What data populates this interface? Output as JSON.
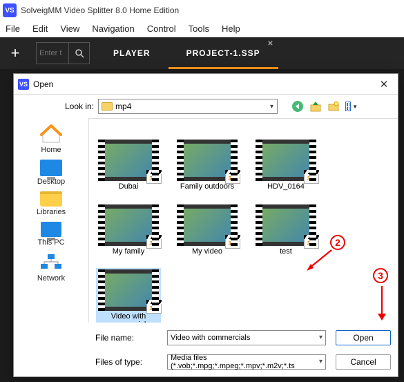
{
  "app": {
    "title": "SolveigMM Video Splitter 8.0 Home Edition",
    "logo_text": "VS"
  },
  "menu": {
    "file": "File",
    "edit": "Edit",
    "view": "View",
    "navigation": "Navigation",
    "control": "Control",
    "tools": "Tools",
    "help": "Help"
  },
  "toolbar": {
    "search_placeholder": "Enter t",
    "player_tab": "PLAYER",
    "project_tab": "PROJECT-1.SSP"
  },
  "dialog": {
    "title": "Open",
    "lookin_label": "Look in:",
    "current_folder": "mp4",
    "places": {
      "home": "Home",
      "desktop": "Desktop",
      "libraries": "Libraries",
      "thispc": "This PC",
      "network": "Network"
    },
    "files": [
      {
        "label": "Dubai"
      },
      {
        "label": "Family outdoors"
      },
      {
        "label": "HDV_0164"
      },
      {
        "label": "My family"
      },
      {
        "label": "My video"
      },
      {
        "label": "test"
      },
      {
        "label": "Video with commercials"
      }
    ],
    "filename_label": "File name:",
    "filename_value": "Video with commercials",
    "filetype_label": "Files of type:",
    "filetype_value": "Media files (*.vob;*.mpg;*.mpeg;*.mpv;*.m2v;*.ts",
    "open_btn": "Open",
    "cancel_btn": "Cancel"
  },
  "annotations": {
    "n2": "2",
    "n3": "3"
  }
}
